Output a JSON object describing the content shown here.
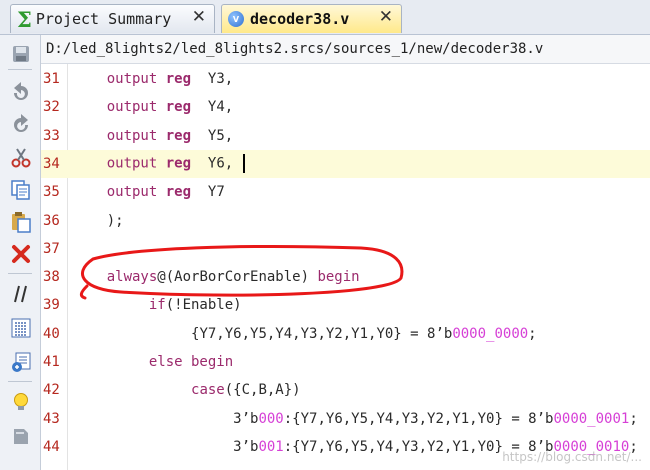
{
  "tabs": [
    {
      "label": "Project Summary",
      "icon": "sigma-icon",
      "active": false
    },
    {
      "label": "decoder38.v",
      "icon": "verilog-file-icon",
      "icon_text": "V",
      "active": true
    }
  ],
  "tab_close_glyph": "✕",
  "sigma_glyph": "Σ",
  "path": "D:/led_8lights2/led_8lights2.srcs/sources_1/new/decoder38.v",
  "toolbar_icons": [
    "save-icon",
    "undo-icon",
    "redo-icon",
    "cut-icon",
    "copy-icon",
    "paste-icon",
    "delete-icon",
    "comment-icon",
    "format-icon",
    "insert-template-icon",
    "lightbulb-icon",
    "settings-icon"
  ],
  "editor": {
    "current_line": 34,
    "lines": [
      {
        "num": "31",
        "indent": "    ",
        "tokens": [
          [
            "kw2",
            "output "
          ],
          [
            "kw",
            "reg"
          ],
          [
            "",
            "  Y3,"
          ]
        ]
      },
      {
        "num": "32",
        "indent": "    ",
        "tokens": [
          [
            "kw2",
            "output "
          ],
          [
            "kw",
            "reg"
          ],
          [
            "",
            "  Y4,"
          ]
        ]
      },
      {
        "num": "33",
        "indent": "    ",
        "tokens": [
          [
            "kw2",
            "output "
          ],
          [
            "kw",
            "reg"
          ],
          [
            "",
            "  Y5,"
          ]
        ]
      },
      {
        "num": "34",
        "indent": "    ",
        "tokens": [
          [
            "kw2",
            "output "
          ],
          [
            "kw",
            "reg"
          ],
          [
            "",
            "  Y6,"
          ]
        ]
      },
      {
        "num": "35",
        "indent": "    ",
        "tokens": [
          [
            "kw2",
            "output "
          ],
          [
            "kw",
            "reg"
          ],
          [
            "",
            "  Y7"
          ]
        ]
      },
      {
        "num": "36",
        "indent": "    ",
        "tokens": [
          [
            "",
            ");"
          ]
        ]
      },
      {
        "num": "37",
        "indent": "",
        "tokens": []
      },
      {
        "num": "38",
        "indent": "    ",
        "tokens": [
          [
            "kw2",
            "always"
          ],
          [
            "",
            "@(AorBorCorEnable) "
          ],
          [
            "kw2",
            "begin"
          ]
        ]
      },
      {
        "num": "39",
        "indent": "         ",
        "tokens": [
          [
            "kw2",
            "if"
          ],
          [
            "",
            "(!Enable)"
          ]
        ]
      },
      {
        "num": "40",
        "indent": "              ",
        "tokens": [
          [
            "",
            "{Y7,Y6,Y5,Y4,Y3,Y2,Y1,Y0} = 8’b"
          ],
          [
            "num",
            "0000_0000"
          ],
          [
            "",
            ";"
          ]
        ]
      },
      {
        "num": "41",
        "indent": "         ",
        "tokens": [
          [
            "kw2",
            "else begin"
          ]
        ]
      },
      {
        "num": "42",
        "indent": "              ",
        "tokens": [
          [
            "kw2",
            "case"
          ],
          [
            "",
            "({C,B,A})"
          ]
        ]
      },
      {
        "num": "43",
        "indent": "                   ",
        "tokens": [
          [
            "",
            "3’b"
          ],
          [
            "num",
            "000"
          ],
          [
            "",
            ":{Y7,Y6,Y5,Y4,Y3,Y2,Y1,Y0} = 8’b"
          ],
          [
            "num",
            "0000_0001"
          ],
          [
            "",
            ";"
          ]
        ]
      },
      {
        "num": "44",
        "indent": "                   ",
        "tokens": [
          [
            "",
            "3’b"
          ],
          [
            "num",
            "001"
          ],
          [
            "",
            ":{Y7,Y6,Y5,Y4,Y3,Y2,Y1,Y0} = 8’b"
          ],
          [
            "num",
            "0000_0010"
          ],
          [
            "",
            ";"
          ]
        ]
      }
    ]
  },
  "watermark": "https://blog.csdn.net/..."
}
